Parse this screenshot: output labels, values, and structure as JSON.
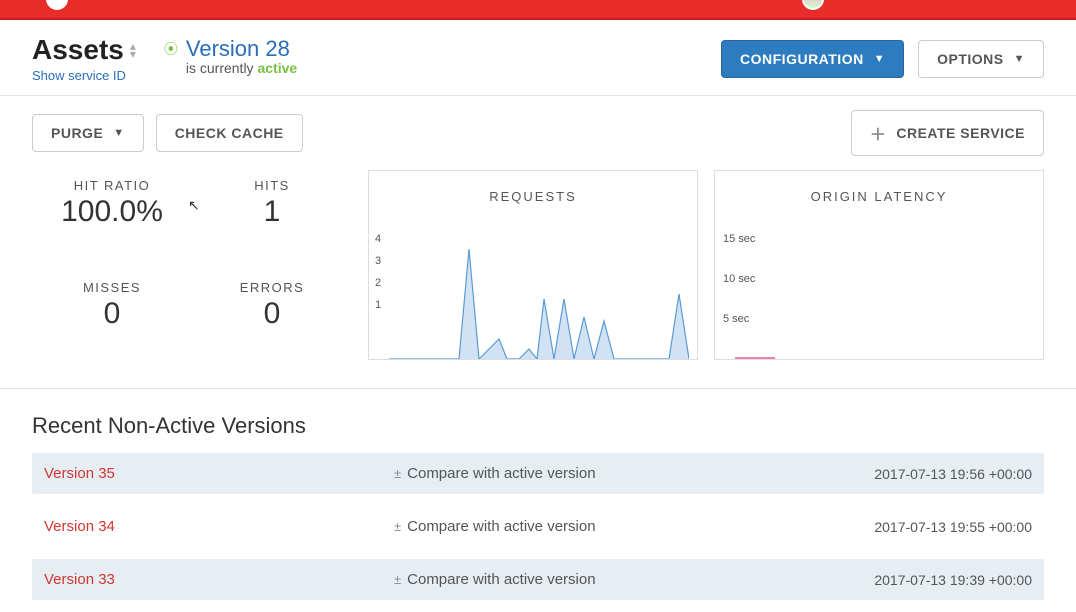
{
  "header": {
    "service_name": "Assets",
    "show_id_label": "Show service ID",
    "version_label": "Version 28",
    "active_prefix": "is currently ",
    "active_word": "active",
    "configuration_label": "CONFIGURATION",
    "options_label": "OPTIONS"
  },
  "toolbar": {
    "purge_label": "PURGE",
    "check_cache_label": "CHECK CACHE",
    "create_service_label": "CREATE SERVICE"
  },
  "stats": {
    "hit_ratio_label": "HIT RATIO",
    "hit_ratio_value": "100.0%",
    "hits_label": "HITS",
    "hits_value": "1",
    "misses_label": "MISSES",
    "misses_value": "0",
    "errors_label": "ERRORS",
    "errors_value": "0"
  },
  "charts": {
    "requests_title": "REQUESTS",
    "latency_title": "ORIGIN LATENCY",
    "requests_y": [
      "4",
      "3",
      "2",
      "1"
    ],
    "latency_y": [
      "15 sec",
      "10 sec",
      "5 sec"
    ]
  },
  "chart_data": [
    {
      "type": "line",
      "title": "REQUESTS",
      "ylabel": "",
      "ylim": [
        0,
        4
      ],
      "y_ticks": [
        1,
        2,
        3,
        4
      ],
      "series": [
        {
          "name": "requests",
          "values": [
            0,
            0,
            0,
            0,
            0,
            0,
            4,
            0,
            0.5,
            0.8,
            0,
            0,
            0.5,
            0,
            2.2,
            0,
            2.2,
            0,
            1.6,
            0,
            1.4,
            0,
            0,
            0,
            0,
            0,
            0,
            0,
            2.3,
            0
          ]
        }
      ]
    },
    {
      "type": "line",
      "title": "ORIGIN LATENCY",
      "ylabel": "seconds",
      "ylim": [
        0,
        15
      ],
      "y_ticks": [
        5,
        10,
        15
      ],
      "series": [
        {
          "name": "latency",
          "values": []
        }
      ]
    }
  ],
  "recent": {
    "title": "Recent Non-Active Versions",
    "compare_label": "Compare with active version",
    "items": [
      {
        "name": "Version 35",
        "time": "2017-07-13 19:56 +00:00"
      },
      {
        "name": "Version 34",
        "time": "2017-07-13 19:55 +00:00"
      },
      {
        "name": "Version 33",
        "time": "2017-07-13 19:39 +00:00"
      }
    ]
  }
}
